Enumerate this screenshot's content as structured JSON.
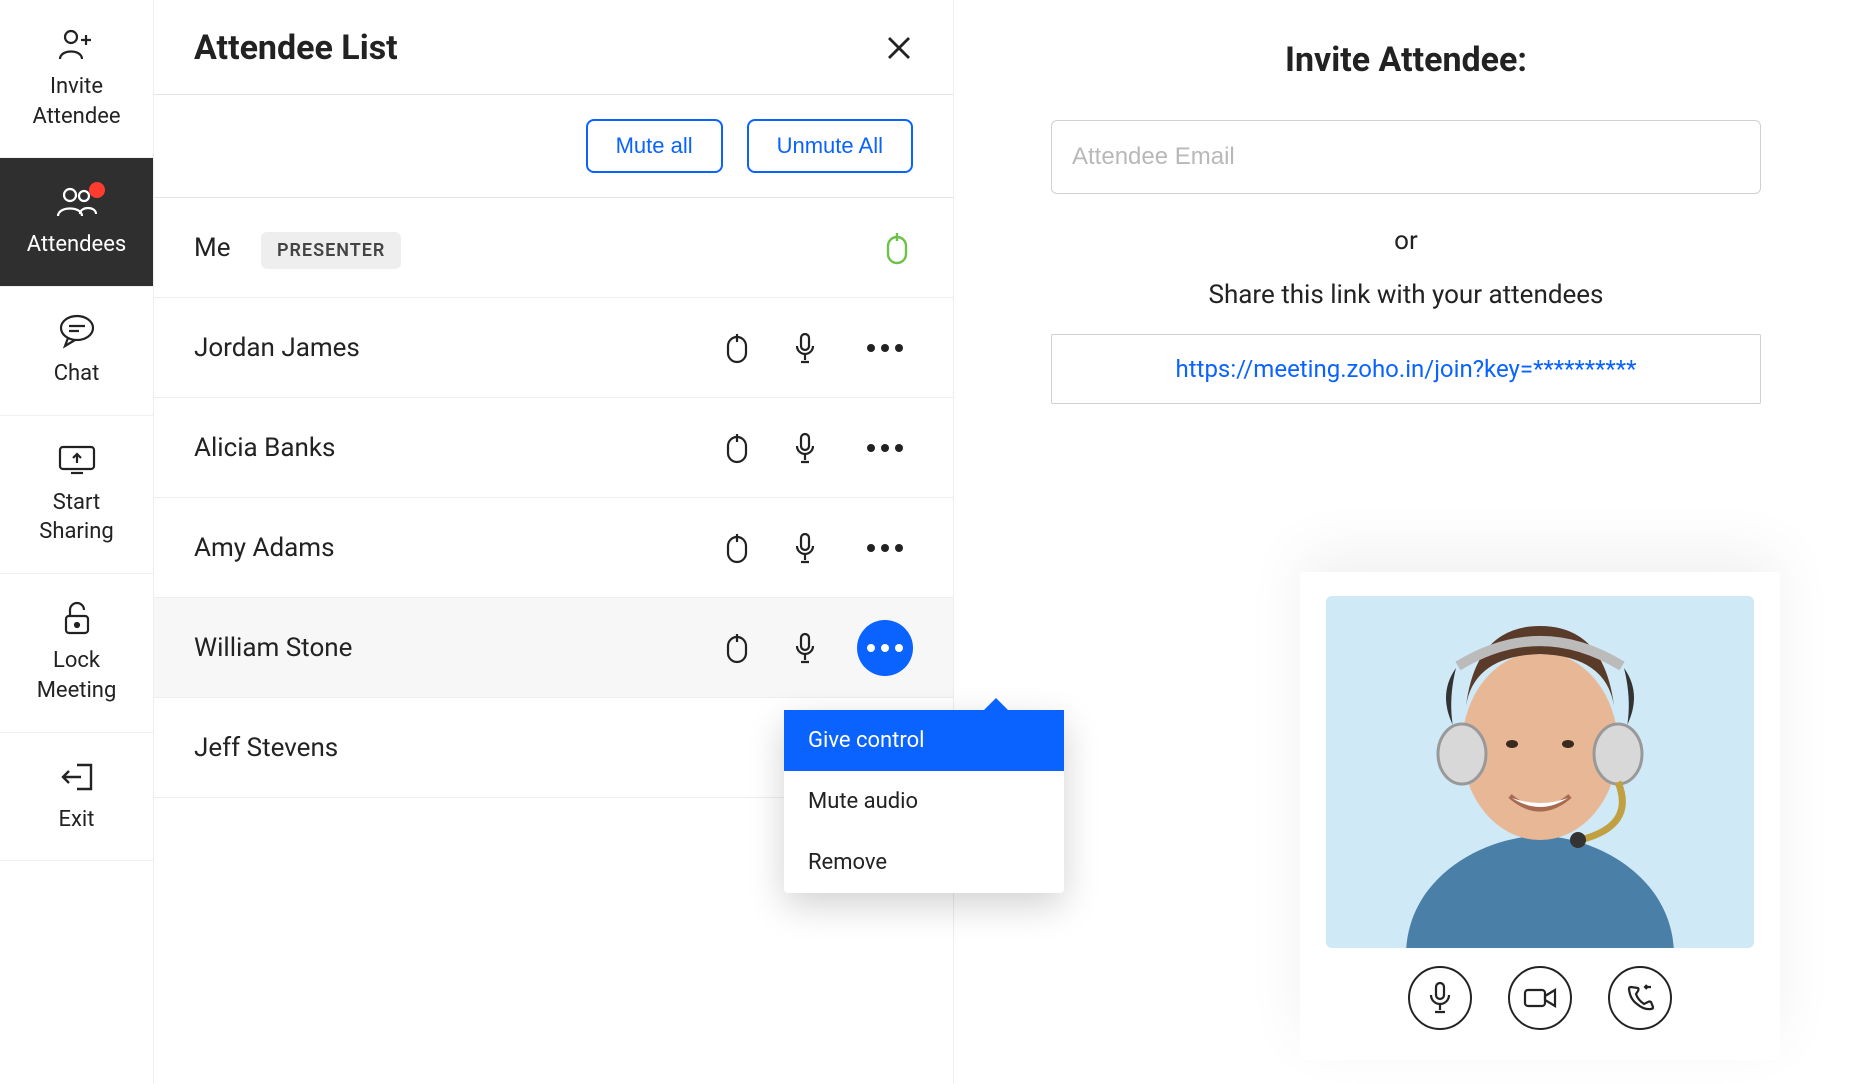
{
  "sidebar": {
    "items": [
      {
        "label": "Invite\nAttendee",
        "icon": "person-plus-icon"
      },
      {
        "label": "Attendees",
        "icon": "group-icon",
        "active": true,
        "notif": true
      },
      {
        "label": "Chat",
        "icon": "chat-icon"
      },
      {
        "label": "Start\nSharing",
        "icon": "screen-share-icon"
      },
      {
        "label": "Lock\nMeeting",
        "icon": "lock-open-icon"
      },
      {
        "label": "Exit",
        "icon": "exit-icon"
      }
    ]
  },
  "panel": {
    "title": "Attendee List",
    "mute_all_label": "Mute all",
    "unmute_all_label": "Unmute All"
  },
  "attendees": [
    {
      "name": "Me",
      "badge": "PRESENTER",
      "mouse_green": true
    },
    {
      "name": "Jordan James"
    },
    {
      "name": "Alicia Banks"
    },
    {
      "name": "Amy Adams"
    },
    {
      "name": "William Stone",
      "hovered": true,
      "menu_open": true
    },
    {
      "name": "Jeff Stevens"
    }
  ],
  "popover": {
    "items": [
      {
        "label": "Give control",
        "active": true
      },
      {
        "label": "Mute audio"
      },
      {
        "label": "Remove"
      }
    ]
  },
  "invite": {
    "title": "Invite Attendee:",
    "placeholder": "Attendee Email",
    "or_label": "or",
    "share_text": "Share this link with your attendees",
    "link": "https://meeting.zoho.in/join?key=**********"
  },
  "video": {
    "controls": [
      "mic-icon",
      "video-icon",
      "phone-icon"
    ]
  }
}
